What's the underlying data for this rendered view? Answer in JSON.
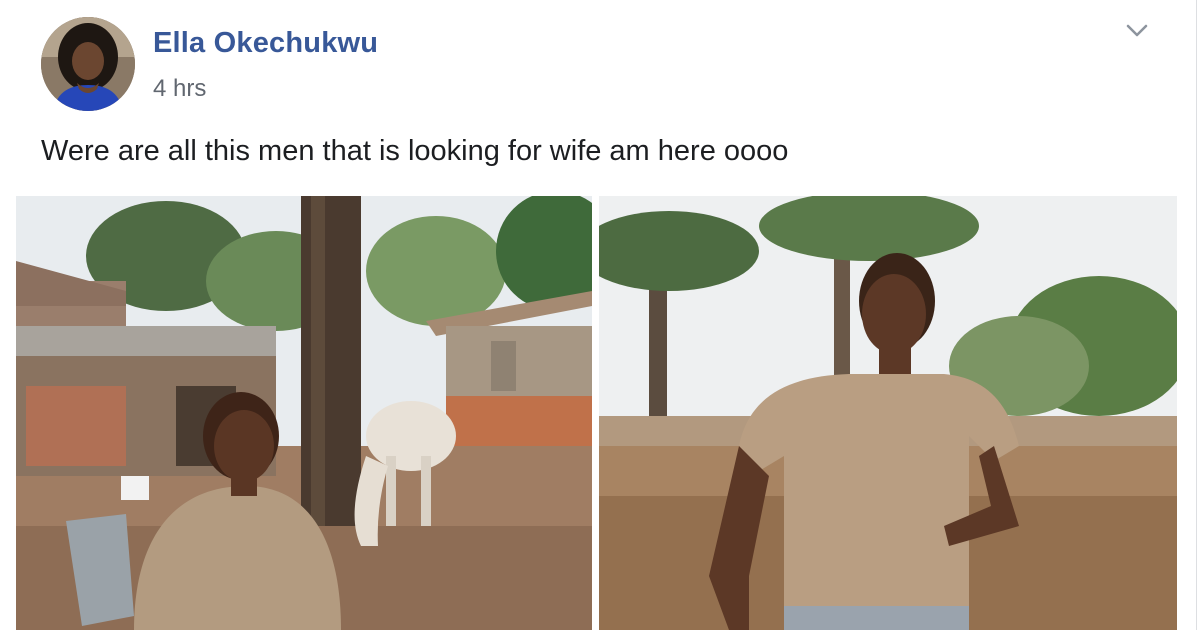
{
  "post": {
    "author_name": "Ella Okechukwu",
    "timestamp": "4 hrs",
    "text": "Were are all this men that is looking for wife am here oooo"
  },
  "icons": {
    "post_menu": "chevron-down-icon"
  },
  "colors": {
    "author_link": "#385898",
    "timestamp": "#616770",
    "body_text": "#1c1e21"
  },
  "photos": [
    "woman-with-cow-photo",
    "woman-in-field-photo"
  ]
}
